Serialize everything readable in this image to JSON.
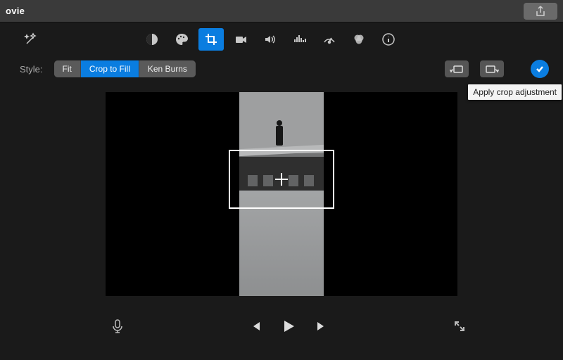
{
  "titlebar": {
    "title": "ovie"
  },
  "toolbar": {
    "tools": [
      {
        "name": "balance",
        "active": false
      },
      {
        "name": "palette",
        "active": false
      },
      {
        "name": "crop",
        "active": true
      },
      {
        "name": "stabilize",
        "active": false
      },
      {
        "name": "volume",
        "active": false
      },
      {
        "name": "eq",
        "active": false
      },
      {
        "name": "speed",
        "active": false
      },
      {
        "name": "filter",
        "active": false
      },
      {
        "name": "info",
        "active": false
      }
    ]
  },
  "style": {
    "label": "Style:",
    "options": [
      "Fit",
      "Crop to Fill",
      "Ken Burns"
    ],
    "selected": "Crop to Fill"
  },
  "apply": {
    "tooltip": "Apply crop adjustment"
  },
  "colors": {
    "accent": "#0a7de0"
  }
}
